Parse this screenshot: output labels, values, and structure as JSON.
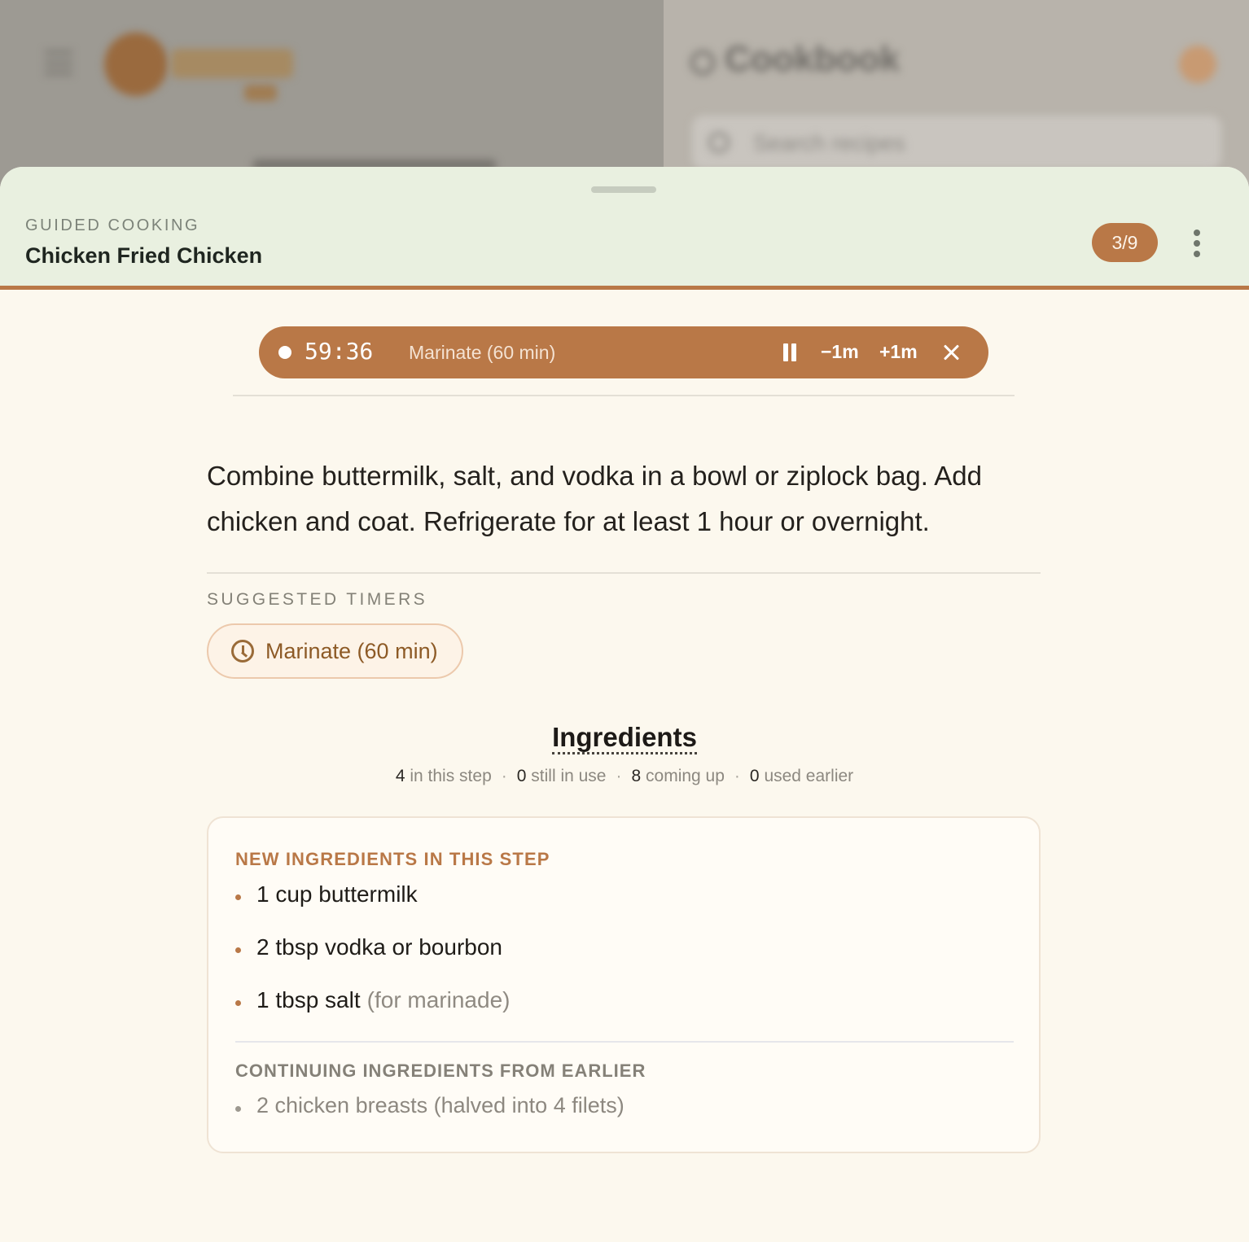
{
  "background": {
    "title": "Cookbook",
    "search_placeholder": "Search recipes"
  },
  "sheet": {
    "eyebrow": "GUIDED COOKING",
    "recipe_title": "Chicken Fried Chicken",
    "step_indicator": "3/9"
  },
  "timer": {
    "time": "59:36",
    "label": "Marinate (60 min)",
    "minus_label": "−1m",
    "plus_label": "+1m",
    "running": true
  },
  "instruction": "Combine buttermilk, salt, and vodka in a bowl or ziplock bag. Add chicken and coat. Refrigerate for at least 1 hour or overnight.",
  "suggested_timers": {
    "heading": "SUGGESTED TIMERS",
    "items": [
      {
        "label": "Marinate (60 min)",
        "icon": "clock-icon"
      }
    ]
  },
  "ingredients": {
    "title": "Ingredients",
    "stats": [
      {
        "count": "4",
        "label": "in this step"
      },
      {
        "count": "0",
        "label": "still in use"
      },
      {
        "count": "8",
        "label": "coming up"
      },
      {
        "count": "0",
        "label": "used earlier"
      }
    ],
    "new_heading": "NEW INGREDIENTS IN THIS STEP",
    "new_items": [
      {
        "text": "1 cup buttermilk",
        "note": ""
      },
      {
        "text": "2 tbsp vodka or bourbon",
        "note": ""
      },
      {
        "text": "1 tbsp salt",
        "note": "(for marinade)"
      }
    ],
    "continuing_heading": "CONTINUING INGREDIENTS FROM EARLIER",
    "continuing_items": [
      {
        "text": "2 chicken breasts (halved into 4 filets)"
      }
    ]
  },
  "colors": {
    "accent": "#b97847",
    "header_bg": "#e9f0e0",
    "page_bg": "#fcf8ee"
  }
}
